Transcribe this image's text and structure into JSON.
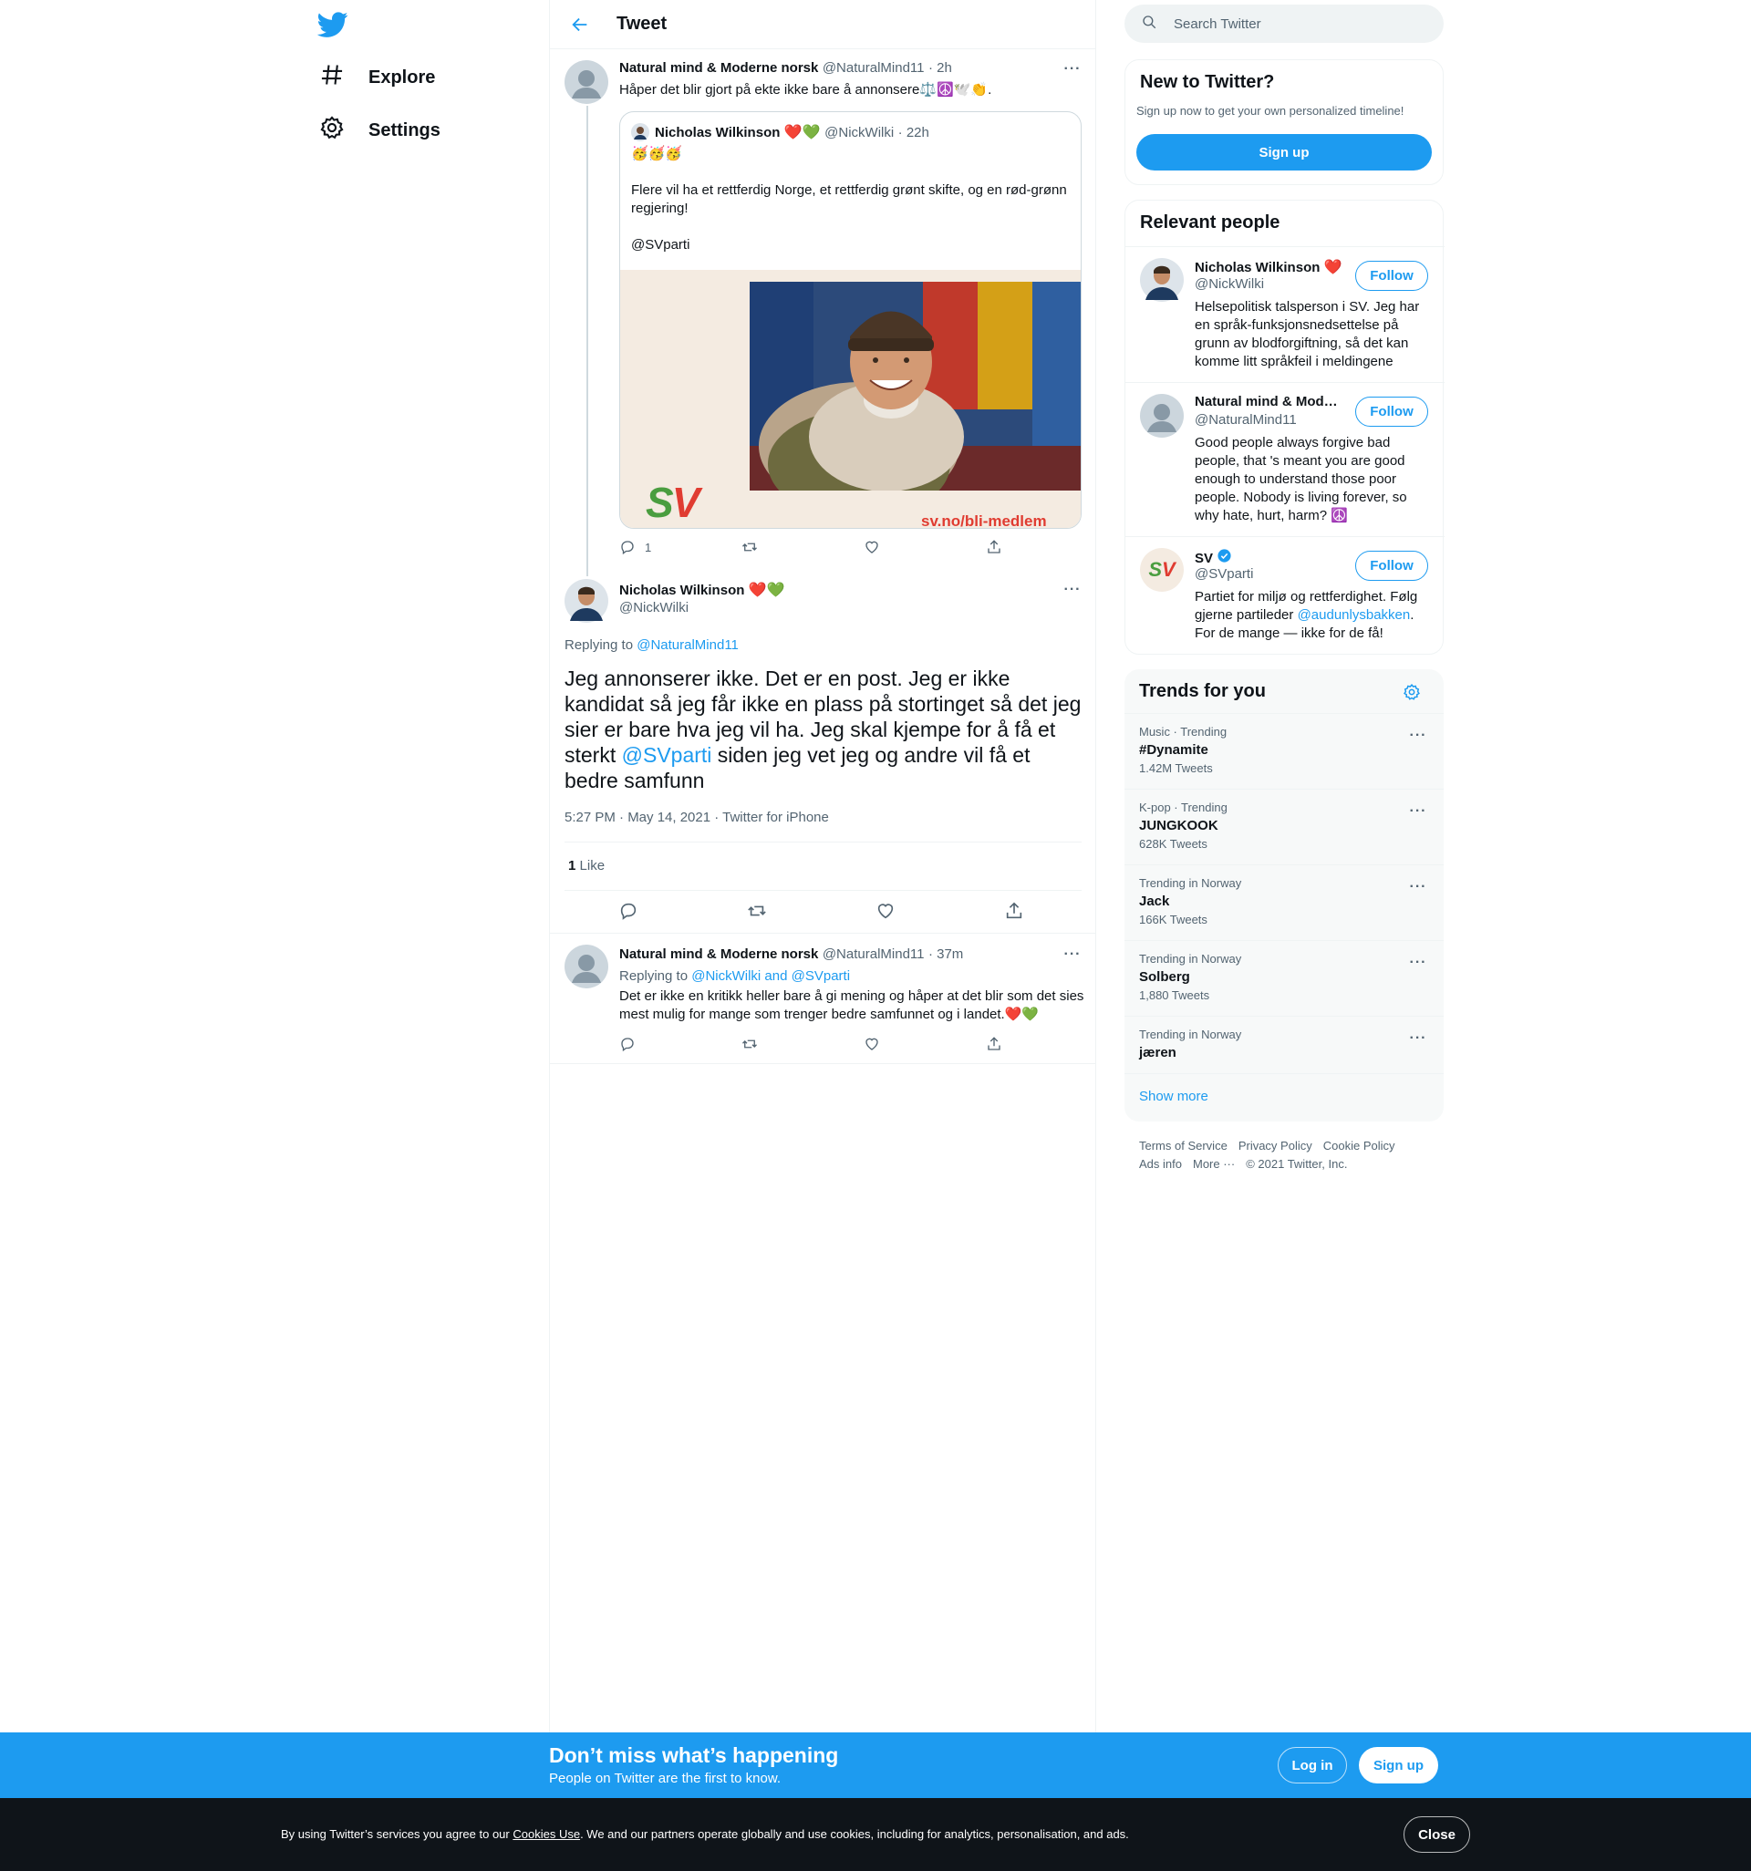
{
  "nav": {
    "explore_label": "Explore",
    "settings_label": "Settings"
  },
  "header": {
    "title": "Tweet"
  },
  "tweet1": {
    "name": "Natural mind & Moderne norsk",
    "handle": "@NaturalMind11",
    "time": "· 2h",
    "text": "Håper det blir gjort på ekte ikke bare å annonsere⚖️☮️🕊️👏.",
    "quote": {
      "name": "Nicholas Wilkinson",
      "emoji": "❤️💚",
      "handle": "@NickWilki",
      "time": "· 22h",
      "line1": "🥳🥳🥳",
      "line2": "Flere vil ha et rettferdig Norge, et rettferdig grønt skifte, og en rød-grønn regjering!",
      "line3": "@SVparti",
      "image_logo": "SV",
      "image_url_text": "sv.no/bli-medlem"
    },
    "reply_count": "1"
  },
  "main_tweet": {
    "name": "Nicholas Wilkinson",
    "emoji": "❤️💚",
    "handle": "@NickWilki",
    "replying_prefix": "Replying to",
    "replying_to": "@NaturalMind11",
    "text_before": "Jeg annonserer ikke. Det er en post. Jeg er ikke kandidat så jeg får ikke en plass på stortinget så det jeg sier er bare hva jeg vil ha. Jeg skal kjempe for å få et sterkt ",
    "mention": "@SVparti",
    "text_after": " siden jeg vet jeg og andre vil få et bedre samfunn",
    "timestamp": "5:27 PM · May 14, 2021 · Twitter for iPhone",
    "likes_count": "1",
    "likes_label": "Like"
  },
  "reply_tweet": {
    "name": "Natural mind & Moderne norsk",
    "handle": "@NaturalMind11",
    "time": "· 37m",
    "replying_prefix": "Replying to",
    "replying_to": "@NickWilki and @SVparti",
    "text": "Det er ikke en kritikk heller bare å gi mening og håper at det blir som det sies mest mulig for mange som trenger bedre samfunnet og i landet.❤️💚"
  },
  "search": {
    "placeholder": "Search Twitter"
  },
  "new_to_twitter": {
    "title": "New to Twitter?",
    "subtitle": "Sign up now to get your own personalized timeline!",
    "button": "Sign up"
  },
  "relevant_people": {
    "title": "Relevant people",
    "follow_label": "Follow",
    "people": [
      {
        "name": "Nicholas Wilkinson",
        "emoji": "❤️",
        "handle": "@NickWilki",
        "bio": "Helsepolitisk talsperson i SV. Jeg har en språk-funksjonsnedsettelse på grunn av blodforgiftning, så det kan komme litt språkfeil i meldingene"
      },
      {
        "name": "Natural mind & Mod…",
        "handle": "@NaturalMind11",
        "bio": "Good people always forgive bad people, that 's meant you are good enough to understand those poor people. Nobody is living forever, so why hate, hurt, harm? ☮️"
      },
      {
        "name": "SV",
        "handle": "@SVparti",
        "bio_before": "Partiet for miljø og rettferdighet. Følg gjerne partileder ",
        "bio_link": "@audunlysbakken",
        "bio_after": ".",
        "bio_line2": "For de mange — ikke for de få!",
        "avatar_text": "SV"
      }
    ]
  },
  "trends": {
    "title": "Trends for you",
    "items": [
      {
        "meta": "Music · Trending",
        "name": "#Dynamite",
        "count": "1.42M Tweets"
      },
      {
        "meta": "K-pop · Trending",
        "name": "JUNGKOOK",
        "count": "628K Tweets"
      },
      {
        "meta": "Trending in Norway",
        "name": "Jack",
        "count": "166K Tweets"
      },
      {
        "meta": "Trending in Norway",
        "name": "Solberg",
        "count": "1,880 Tweets"
      },
      {
        "meta": "Trending in Norway",
        "name": "jæren",
        "count": ""
      }
    ],
    "show_more": "Show more"
  },
  "footer": {
    "terms": "Terms of Service",
    "privacy": "Privacy Policy",
    "cookie": "Cookie Policy",
    "ads": "Ads info",
    "more": "More ···",
    "copyright": "© 2021 Twitter, Inc."
  },
  "signup_banner": {
    "title": "Don’t miss what’s happening",
    "subtitle": "People on Twitter are the first to know.",
    "login": "Log in",
    "signup": "Sign up"
  },
  "cookie_banner": {
    "text_before": "By using Twitter’s services you agree to our ",
    "link": "Cookies Use",
    "text_after": ". We and our partners operate globally and use cookies, including for analytics, personalisation, and ads.",
    "close": "Close"
  },
  "colors": {
    "accent": "#1d9bf0",
    "text": "#0f1419",
    "muted": "#536471",
    "banner_dark": "#0f1419",
    "sv_green": "#4a9d3f",
    "sv_red": "#e03c31"
  }
}
